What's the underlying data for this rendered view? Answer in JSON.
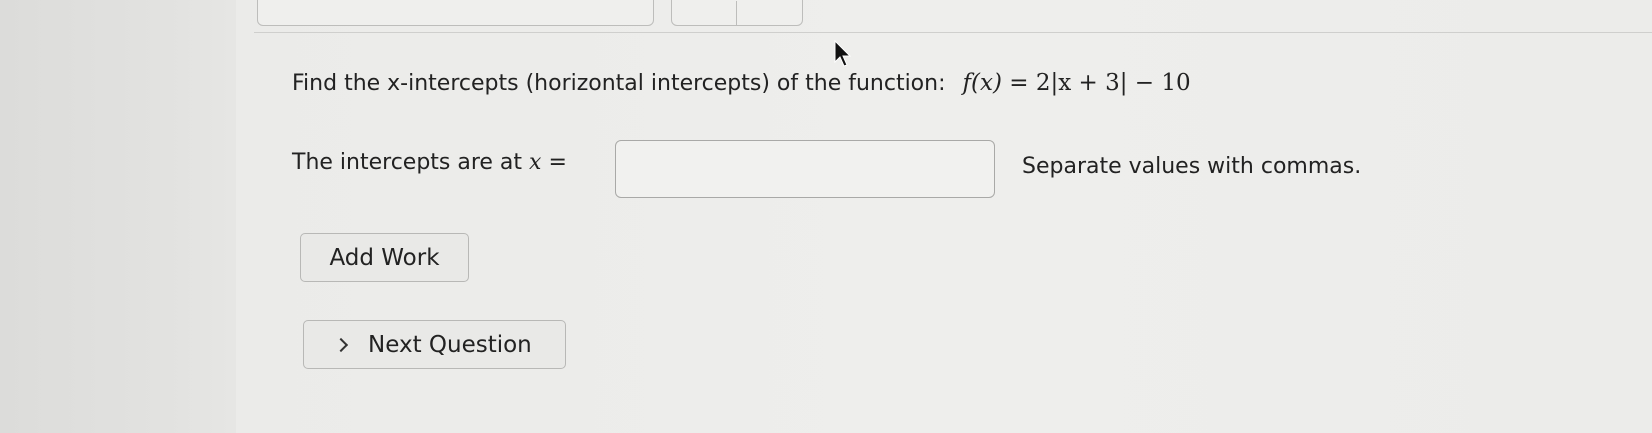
{
  "question": {
    "prompt": "Find the x-intercepts (horizontal intercepts) of the function:",
    "function_lhs": "f(x)",
    "function_rhs": "= 2|x + 3| − 10"
  },
  "answer": {
    "label": "The intercepts are at",
    "variable": "x",
    "equals": "=",
    "input_value": "",
    "hint": "Separate values with commas."
  },
  "buttons": {
    "add_work": "Add Work",
    "next_question": "Next Question"
  },
  "icons": {
    "next": "chevron-right-icon",
    "cursor": "mouse-pointer-icon"
  }
}
